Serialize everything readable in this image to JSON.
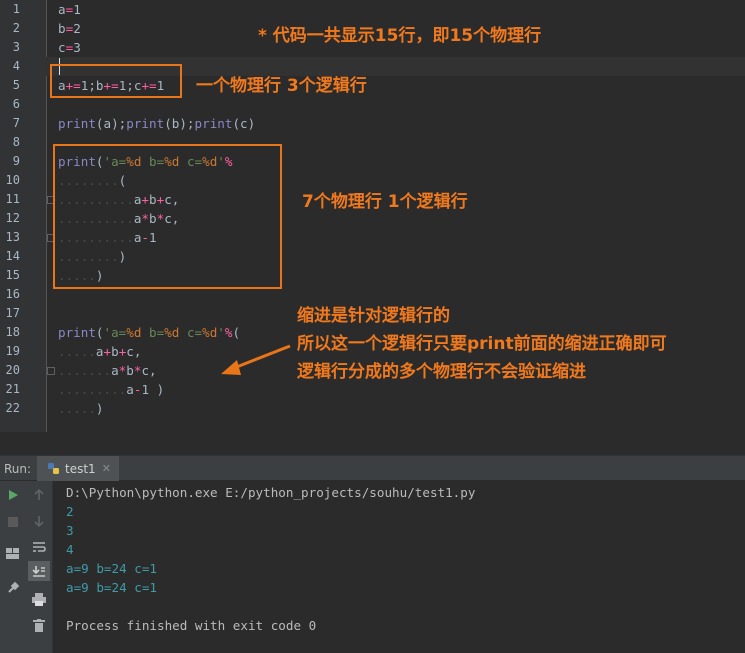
{
  "editor": {
    "line_numbers": [
      "1",
      "2",
      "3",
      "4",
      "5",
      "6",
      "7",
      "8",
      "9",
      "10",
      "11",
      "12",
      "13",
      "14",
      "15",
      "16",
      "17",
      "18",
      "19",
      "20",
      "21",
      "22"
    ],
    "lines": [
      {
        "tokens": [
          {
            "t": "a",
            "c": "p"
          },
          {
            "t": "=",
            "c": "op"
          },
          {
            "t": "1",
            "c": "p"
          }
        ]
      },
      {
        "tokens": [
          {
            "t": "b",
            "c": "p"
          },
          {
            "t": "=",
            "c": "op"
          },
          {
            "t": "2",
            "c": "p"
          }
        ]
      },
      {
        "tokens": [
          {
            "t": "c",
            "c": "p"
          },
          {
            "t": "=",
            "c": "op"
          },
          {
            "t": "3",
            "c": "p"
          }
        ]
      },
      {
        "tokens": []
      },
      {
        "tokens": [
          {
            "t": "a",
            "c": "p"
          },
          {
            "t": "+=",
            "c": "op"
          },
          {
            "t": "1;b",
            "c": "p"
          },
          {
            "t": "+=",
            "c": "op"
          },
          {
            "t": "1;c",
            "c": "p"
          },
          {
            "t": "+=",
            "c": "op"
          },
          {
            "t": "1",
            "c": "p"
          }
        ]
      },
      {
        "tokens": []
      },
      {
        "tokens": [
          {
            "t": "print",
            "c": "fn"
          },
          {
            "t": "(a);",
            "c": "p"
          },
          {
            "t": "print",
            "c": "fn"
          },
          {
            "t": "(b);",
            "c": "p"
          },
          {
            "t": "print",
            "c": "fn"
          },
          {
            "t": "(c)",
            "c": "p"
          }
        ]
      },
      {
        "tokens": []
      },
      {
        "tokens": [
          {
            "t": "print",
            "c": "fn"
          },
          {
            "t": "(",
            "c": "p"
          },
          {
            "t": "'a=",
            "c": "str"
          },
          {
            "t": "%d",
            "c": "fmt"
          },
          {
            "t": " b=",
            "c": "str"
          },
          {
            "t": "%d",
            "c": "fmt"
          },
          {
            "t": " c=",
            "c": "str"
          },
          {
            "t": "%d",
            "c": "fmt"
          },
          {
            "t": "'",
            "c": "str"
          },
          {
            "t": "%",
            "c": "op"
          }
        ]
      },
      {
        "tokens": [
          {
            "t": "........",
            "c": "dot"
          },
          {
            "t": "(",
            "c": "p"
          }
        ]
      },
      {
        "tokens": [
          {
            "t": "..........",
            "c": "dot"
          },
          {
            "t": "a",
            "c": "p"
          },
          {
            "t": "+",
            "c": "op"
          },
          {
            "t": "b",
            "c": "p"
          },
          {
            "t": "+",
            "c": "op"
          },
          {
            "t": "c,",
            "c": "p"
          }
        ]
      },
      {
        "tokens": [
          {
            "t": "..........",
            "c": "dot"
          },
          {
            "t": "a",
            "c": "p"
          },
          {
            "t": "*",
            "c": "op"
          },
          {
            "t": "b",
            "c": "p"
          },
          {
            "t": "*",
            "c": "op"
          },
          {
            "t": "c,",
            "c": "p"
          }
        ]
      },
      {
        "tokens": [
          {
            "t": "..........",
            "c": "dot"
          },
          {
            "t": "a",
            "c": "p"
          },
          {
            "t": "-",
            "c": "op"
          },
          {
            "t": "1",
            "c": "p"
          }
        ]
      },
      {
        "tokens": [
          {
            "t": "........",
            "c": "dot"
          },
          {
            "t": ")",
            "c": "p"
          }
        ]
      },
      {
        "tokens": [
          {
            "t": ".....",
            "c": "dot"
          },
          {
            "t": ")",
            "c": "p"
          }
        ]
      },
      {
        "tokens": []
      },
      {
        "tokens": []
      },
      {
        "tokens": [
          {
            "t": "print",
            "c": "fn"
          },
          {
            "t": "(",
            "c": "p"
          },
          {
            "t": "'a=",
            "c": "str"
          },
          {
            "t": "%d",
            "c": "fmt"
          },
          {
            "t": " b=",
            "c": "str"
          },
          {
            "t": "%d",
            "c": "fmt"
          },
          {
            "t": " c=",
            "c": "str"
          },
          {
            "t": "%d",
            "c": "fmt"
          },
          {
            "t": "'",
            "c": "str"
          },
          {
            "t": "%",
            "c": "op"
          },
          {
            "t": "(",
            "c": "p"
          }
        ]
      },
      {
        "tokens": [
          {
            "t": ".....",
            "c": "dot"
          },
          {
            "t": "a",
            "c": "p"
          },
          {
            "t": "+",
            "c": "op"
          },
          {
            "t": "b",
            "c": "p"
          },
          {
            "t": "+",
            "c": "op"
          },
          {
            "t": "c,",
            "c": "p"
          }
        ]
      },
      {
        "tokens": [
          {
            "t": ".......",
            "c": "dot"
          },
          {
            "t": "a",
            "c": "p"
          },
          {
            "t": "*",
            "c": "op"
          },
          {
            "t": "b",
            "c": "p"
          },
          {
            "t": "*",
            "c": "op"
          },
          {
            "t": "c,",
            "c": "p"
          }
        ]
      },
      {
        "tokens": [
          {
            "t": ".........",
            "c": "dot"
          },
          {
            "t": "a",
            "c": "p"
          },
          {
            "t": "-",
            "c": "op"
          },
          {
            "t": "1 )",
            "c": "p"
          }
        ]
      },
      {
        "tokens": [
          {
            "t": ".....",
            "c": "dot"
          },
          {
            "t": ")",
            "c": "p"
          }
        ]
      }
    ]
  },
  "annotations": {
    "note_top": "* 代码一共显示15行，即15个物理行",
    "note_line5": "一个物理行 3个逻辑行",
    "note_block": "7个物理行 1个逻辑行",
    "note_indent_1": "缩进是针对逻辑行的",
    "note_indent_2": "所以这一个逻辑行只要print前面的缩进正确即可",
    "note_indent_3": "逻辑行分成的多个物理行不会验证缩进"
  },
  "run": {
    "label": "Run:",
    "tab_name": "test1",
    "output": [
      {
        "text": "D:\\Python\\python.exe E:/python_projects/souhu/test1.py",
        "kind": "cmd"
      },
      {
        "text": "2",
        "kind": "val"
      },
      {
        "text": "3",
        "kind": "val"
      },
      {
        "text": "4",
        "kind": "val"
      },
      {
        "text": "a=9 b=24 c=1",
        "kind": "val"
      },
      {
        "text": "a=9 b=24 c=1",
        "kind": "val"
      },
      {
        "text": "",
        "kind": "val"
      },
      {
        "text": "Process finished with exit code 0",
        "kind": "fin"
      }
    ]
  },
  "colors": {
    "annotation": "#f0791e",
    "operator": "#ff5fa2",
    "function": "#8888c6",
    "string": "#6a8759",
    "output": "#3f9ba8"
  },
  "icons": [
    "run-icon",
    "stop-icon",
    "up-icon",
    "down-icon",
    "soft-wrap-icon",
    "scroll-to-end-icon",
    "print-icon",
    "trash-icon",
    "layout-icon",
    "pin-icon",
    "python-icon",
    "close-icon",
    "arrow-annotation-icon"
  ]
}
